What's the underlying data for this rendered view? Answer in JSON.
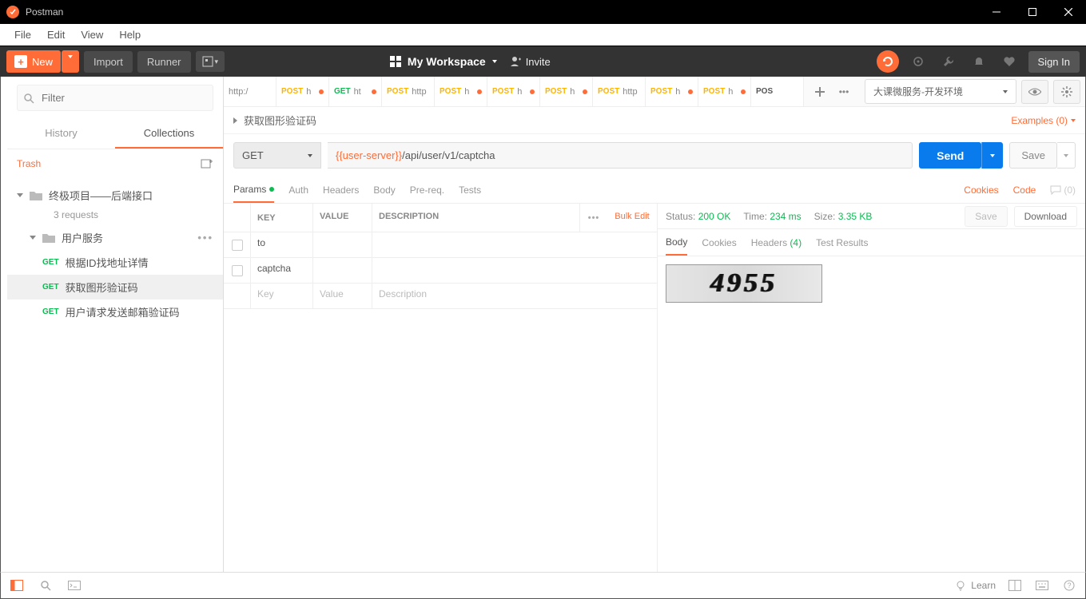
{
  "app": {
    "title": "Postman"
  },
  "menu": {
    "file": "File",
    "edit": "Edit",
    "view": "View",
    "help": "Help"
  },
  "toolbar": {
    "new": "New",
    "import": "Import",
    "runner": "Runner",
    "workspace": "My Workspace",
    "invite": "Invite",
    "signin": "Sign In"
  },
  "sidebar": {
    "filter_placeholder": "Filter",
    "tab_history": "History",
    "tab_collections": "Collections",
    "trash": "Trash",
    "collection": {
      "name": "终极项目——后端接口",
      "sub": "3 requests",
      "folder": "用户服务",
      "requests": [
        {
          "method": "GET",
          "name": "根据ID找地址详情"
        },
        {
          "method": "GET",
          "name": "获取图形验证码"
        },
        {
          "method": "GET",
          "name": "用户请求发送邮箱验证码"
        }
      ]
    }
  },
  "tabs": [
    {
      "method": "",
      "label": "http:/",
      "dot": false
    },
    {
      "method": "POST",
      "label": "h",
      "dot": true
    },
    {
      "method": "GET",
      "label": "ht",
      "dot": true
    },
    {
      "method": "POST",
      "label": "http",
      "dot": false
    },
    {
      "method": "POST",
      "label": "h",
      "dot": true
    },
    {
      "method": "POST",
      "label": "h",
      "dot": true
    },
    {
      "method": "POST",
      "label": "h",
      "dot": true
    },
    {
      "method": "POST",
      "label": "http",
      "dot": false
    },
    {
      "method": "POST",
      "label": "h",
      "dot": true
    },
    {
      "method": "POST",
      "label": "h",
      "dot": true
    },
    {
      "method": "POS",
      "label": "",
      "dot": false
    }
  ],
  "env": {
    "name": "大课微服务-开发环境"
  },
  "request": {
    "title": "获取图形验证码",
    "examples": "Examples (0)",
    "method": "GET",
    "url_server": "{{user-server}}",
    "url_path": "/api/user/v1/captcha",
    "send": "Send",
    "save": "Save",
    "subtabs": {
      "params": "Params",
      "auth": "Auth",
      "headers": "Headers",
      "body": "Body",
      "prereq": "Pre-req.",
      "tests": "Tests",
      "cookies": "Cookies",
      "code": "Code",
      "comments": "(0)"
    },
    "params_table": {
      "key": "KEY",
      "value": "VALUE",
      "desc": "DESCRIPTION",
      "bulk": "Bulk Edit",
      "rows": [
        {
          "key": "to",
          "value": "",
          "desc": ""
        },
        {
          "key": "captcha",
          "value": "",
          "desc": ""
        }
      ],
      "placeholder": {
        "key": "Key",
        "value": "Value",
        "desc": "Description"
      }
    }
  },
  "response": {
    "status_label": "Status:",
    "status_value": "200 OK",
    "time_label": "Time:",
    "time_value": "234 ms",
    "size_label": "Size:",
    "size_value": "3.35 KB",
    "save": "Save",
    "download": "Download",
    "tabs": {
      "body": "Body",
      "cookies": "Cookies",
      "headers": "Headers",
      "headers_count": "(4)",
      "tests": "Test Results"
    },
    "captcha": "4955"
  },
  "bottom": {
    "learn": "Learn"
  }
}
